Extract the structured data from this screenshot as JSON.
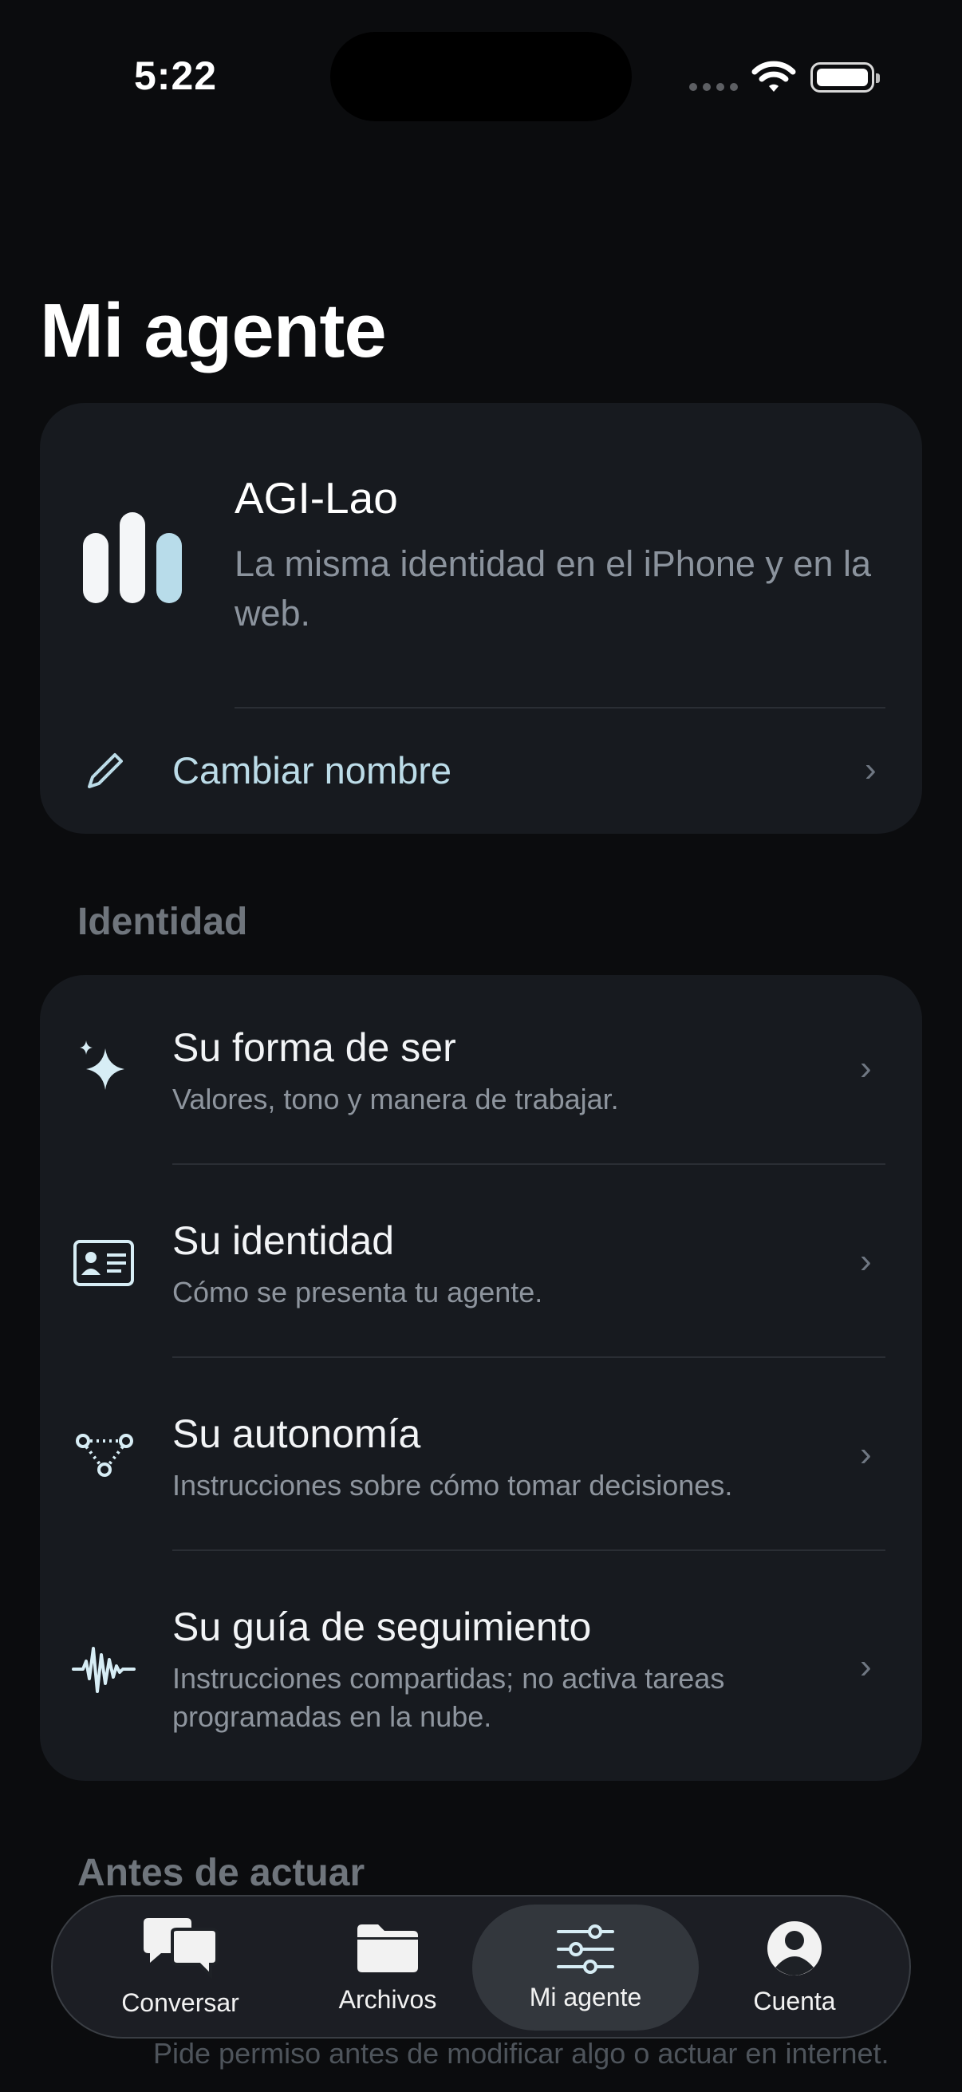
{
  "status": {
    "time": "5:22"
  },
  "page": {
    "title": "Mi agente"
  },
  "agent": {
    "name": "AGI-Lao",
    "description": "La misma identidad en el iPhone y en la web.",
    "rename_label": "Cambiar nombre"
  },
  "identity_section": {
    "title": "Identidad",
    "items": [
      {
        "title": "Su forma de ser",
        "subtitle": "Valores, tono y manera de trabajar.",
        "icon": "sparkles-icon"
      },
      {
        "title": "Su identidad",
        "subtitle": "Cómo se presenta tu agente.",
        "icon": "id-card-icon"
      },
      {
        "title": "Su autonomía",
        "subtitle": "Instrucciones sobre cómo tomar decisiones.",
        "icon": "nodes-icon"
      },
      {
        "title": "Su guía de seguimiento",
        "subtitle": "Instrucciones compartidas; no activa tareas programadas en la nube.",
        "icon": "waveform-icon"
      }
    ]
  },
  "before_section": {
    "title": "Antes de actuar",
    "partial_text": "Pide permiso antes de modificar algo o actuar en internet."
  },
  "tabbar": {
    "tabs": [
      {
        "label": "Conversar",
        "icon": "chat-bubbles-icon"
      },
      {
        "label": "Archivos",
        "icon": "folder-icon"
      },
      {
        "label": "Mi agente",
        "icon": "sliders-icon",
        "active": true
      },
      {
        "label": "Cuenta",
        "icon": "person-circle-icon"
      }
    ]
  },
  "colors": {
    "background": "#0b0c0e",
    "card": "#171a1f",
    "accent": "#bcdce8",
    "secondary_text": "#8e959e"
  }
}
